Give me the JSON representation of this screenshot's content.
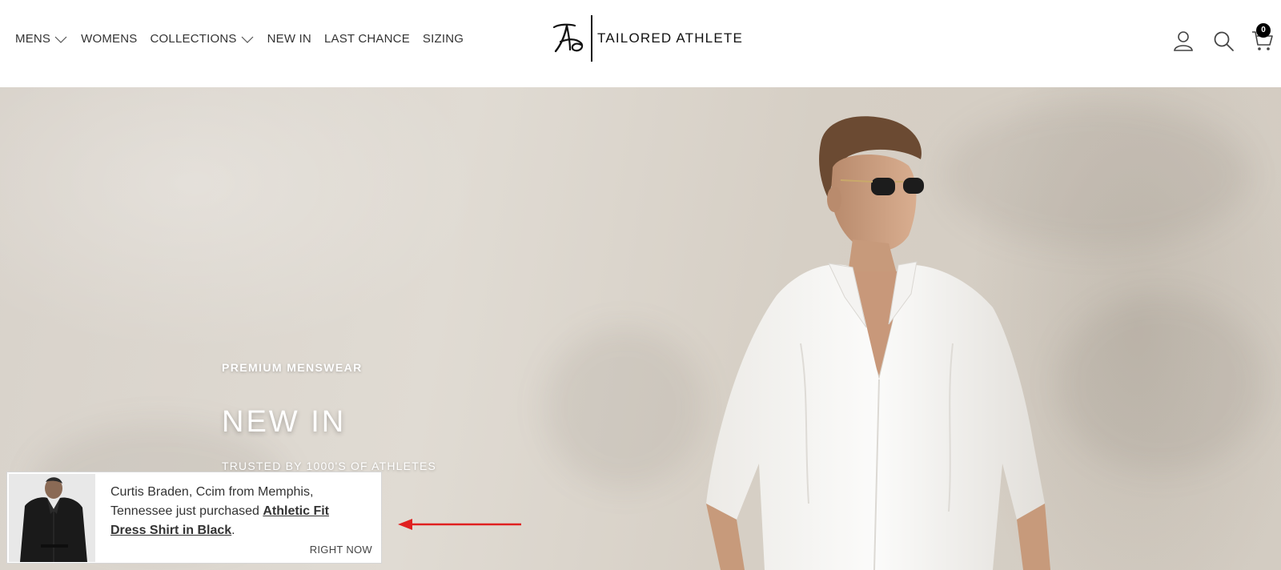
{
  "header": {
    "nav": [
      {
        "label": "MENS",
        "has_dropdown": true
      },
      {
        "label": "WOMENS",
        "has_dropdown": false
      },
      {
        "label": "COLLECTIONS",
        "has_dropdown": true
      },
      {
        "label": "NEW IN",
        "has_dropdown": false
      },
      {
        "label": "LAST CHANCE",
        "has_dropdown": false
      },
      {
        "label": "SIZING",
        "has_dropdown": false
      }
    ],
    "logo_text": "TAILORED ATHLETE",
    "icons": [
      "account-icon",
      "search-icon",
      "cart-icon"
    ],
    "cart_count": "0"
  },
  "hero": {
    "eyebrow": "PREMIUM MENSWEAR",
    "headline": "NEW IN",
    "tagline": "TRUSTED BY 1000'S OF ATHLETES"
  },
  "toast": {
    "message_prefix": "Curtis Braden, Ccim from Memphis, Tennessee just purchased ",
    "product": "Athletic Fit Dress Shirt in Black",
    "message_suffix": ".",
    "time": "RIGHT NOW"
  },
  "colors": {
    "arrow": "#e02020",
    "badge": "#000000",
    "hero_bg": "#dcd6ce"
  }
}
